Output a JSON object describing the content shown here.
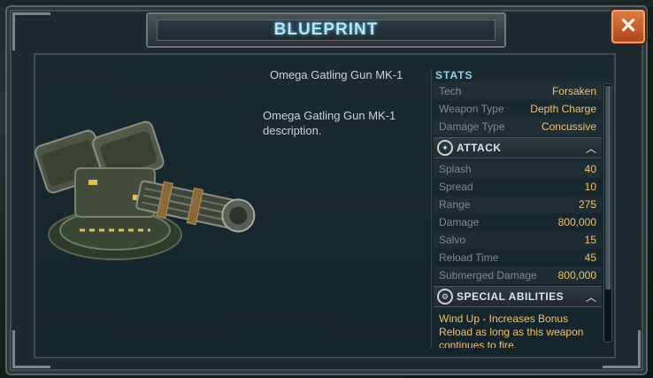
{
  "header": {
    "title": "BLUEPRINT"
  },
  "close_button": {
    "label": "✕",
    "icon": "close-icon"
  },
  "weapon": {
    "name": "Omega Gatling Gun MK-1",
    "description": "Omega Gatling Gun MK-1 description.",
    "image_icon": "gatling-gun-turret"
  },
  "stats": {
    "title": "STATS",
    "general": [
      {
        "label": "Tech",
        "value": "Forsaken"
      },
      {
        "label": "Weapon Type",
        "value": "Depth Charge"
      },
      {
        "label": "Damage Type",
        "value": "Concussive"
      }
    ],
    "attack_section": {
      "title": "ATTACK",
      "icon": "attack-icon"
    },
    "attack": [
      {
        "label": "Splash",
        "value": "40"
      },
      {
        "label": "Spread",
        "value": "10"
      },
      {
        "label": "Range",
        "value": "275"
      },
      {
        "label": "Damage",
        "value": "800,000"
      },
      {
        "label": "Salvo",
        "value": "15"
      },
      {
        "label": "Reload Time",
        "value": "45"
      },
      {
        "label": "Submerged Damage",
        "value": "800,000"
      }
    ],
    "special_section": {
      "title": "SPECIAL ABILITIES",
      "icon": "special-abilities-icon"
    },
    "special_text": "Wind Up - Increases Bonus Reload as long as this weapon continues to fire."
  },
  "colors": {
    "accent": "#b9e4f2",
    "value": "#f0c272",
    "close": "#c85a28"
  }
}
